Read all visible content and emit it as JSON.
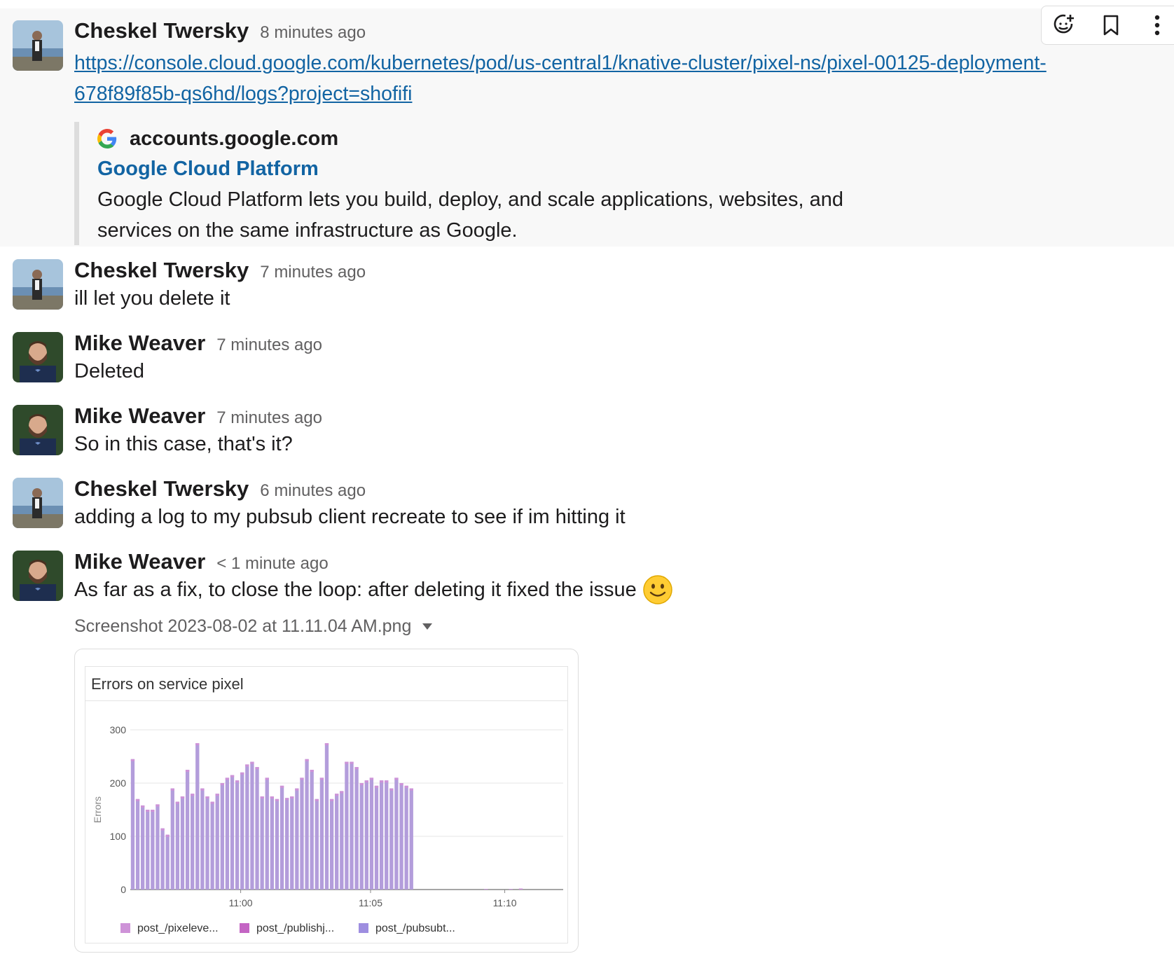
{
  "messages": [
    {
      "author": "Cheskel Twersky",
      "time": "8 minutes ago",
      "link_line1": "https://console.cloud.google.com/kubernetes/pod/us-central1/knative-cluster/pixel-ns/pixel-00125-deployment-",
      "link_line2": "678f89f85b-qs6hd/logs?project=shofifi",
      "unfurl": {
        "source": "accounts.google.com",
        "title": "Google Cloud Platform",
        "desc_line1": "Google Cloud Platform lets you build, deploy, and scale applications, websites, and",
        "desc_line2": "services on the same infrastructure as Google."
      }
    },
    {
      "author": "Cheskel Twersky",
      "time": "7 minutes ago",
      "text": "ill let you delete it"
    },
    {
      "author": "Mike Weaver",
      "time": "7 minutes ago",
      "text": "Deleted"
    },
    {
      "author": "Mike Weaver",
      "time": "7 minutes ago",
      "text": "So in this case, that's it?"
    },
    {
      "author": "Cheskel Twersky",
      "time": "6 minutes ago",
      "text": "adding a log to my pubsub client recreate to see if im hitting it"
    },
    {
      "author": "Mike Weaver",
      "time": "< 1 minute ago",
      "text": "As far as a fix, to close the loop: after deleting it fixed the issue",
      "attachment": {
        "name": "Screenshot 2023-08-02 at 11.11.04 AM.png"
      }
    }
  ],
  "toolbar": {
    "icons": [
      "add-reaction-icon",
      "bookmark-icon",
      "more-actions-icon"
    ]
  },
  "colors": {
    "link": "#1264a3",
    "bar": "#b39ddb",
    "bar_top": "#ce93d8"
  },
  "chart_data": {
    "type": "bar",
    "title": "Errors on service pixel",
    "ylabel": "Errors",
    "ylim": [
      0,
      300
    ],
    "yticks": [
      "0",
      "100",
      "200",
      "300"
    ],
    "xticks": [
      "11:00",
      "11:05",
      "11:10"
    ],
    "legend": [
      "post_/pixeleve...",
      "post_/publishj...",
      "post_/pubsubt..."
    ],
    "values": [
      245,
      170,
      158,
      150,
      150,
      160,
      115,
      103,
      190,
      165,
      175,
      225,
      180,
      275,
      190,
      175,
      165,
      180,
      200,
      210,
      215,
      205,
      220,
      235,
      240,
      230,
      175,
      210,
      175,
      170,
      195,
      172,
      175,
      190,
      210,
      245,
      225,
      170,
      210,
      275,
      170,
      180,
      185,
      240,
      240,
      230,
      200,
      205,
      210,
      195,
      205,
      205,
      190,
      210,
      200,
      195,
      190,
      0,
      0,
      0,
      0,
      0,
      0,
      0,
      0,
      0,
      0,
      0,
      0,
      0,
      0,
      1,
      0,
      0,
      0,
      0,
      1,
      0,
      2,
      0,
      0,
      0,
      0,
      0,
      0,
      0,
      0
    ],
    "legend_colors": [
      "#ce93d8",
      "#c465c4",
      "#9e8ee0"
    ]
  }
}
